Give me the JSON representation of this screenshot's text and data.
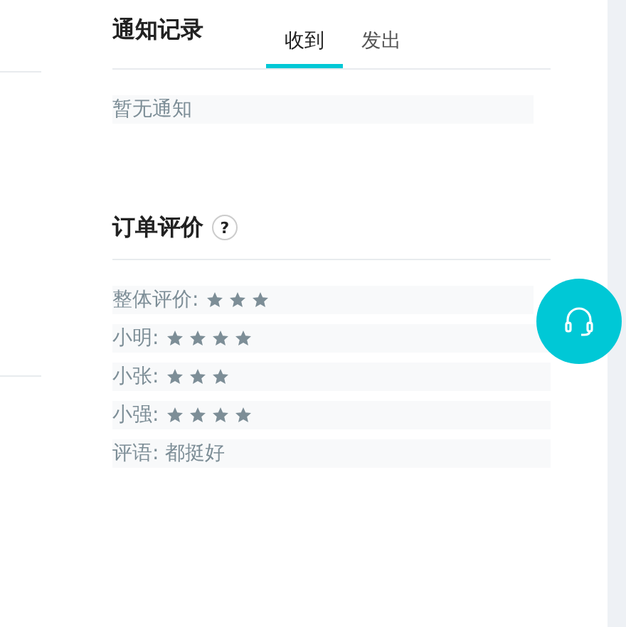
{
  "notifications": {
    "title": "通知记录",
    "tabs": [
      {
        "label": "收到",
        "selected": true
      },
      {
        "label": "发出",
        "selected": false
      }
    ],
    "empty_text": "暂无通知"
  },
  "review": {
    "title": "订单评价",
    "help": "?",
    "rows": [
      {
        "kind": "rating",
        "label": "整体评价:",
        "stars": 3
      },
      {
        "kind": "rating",
        "label": "小明:",
        "stars": 4
      },
      {
        "kind": "rating",
        "label": "小张:",
        "stars": 3
      },
      {
        "kind": "rating",
        "label": "小强:",
        "stars": 4
      },
      {
        "kind": "comment",
        "text": "评语: 都挺好"
      }
    ]
  }
}
